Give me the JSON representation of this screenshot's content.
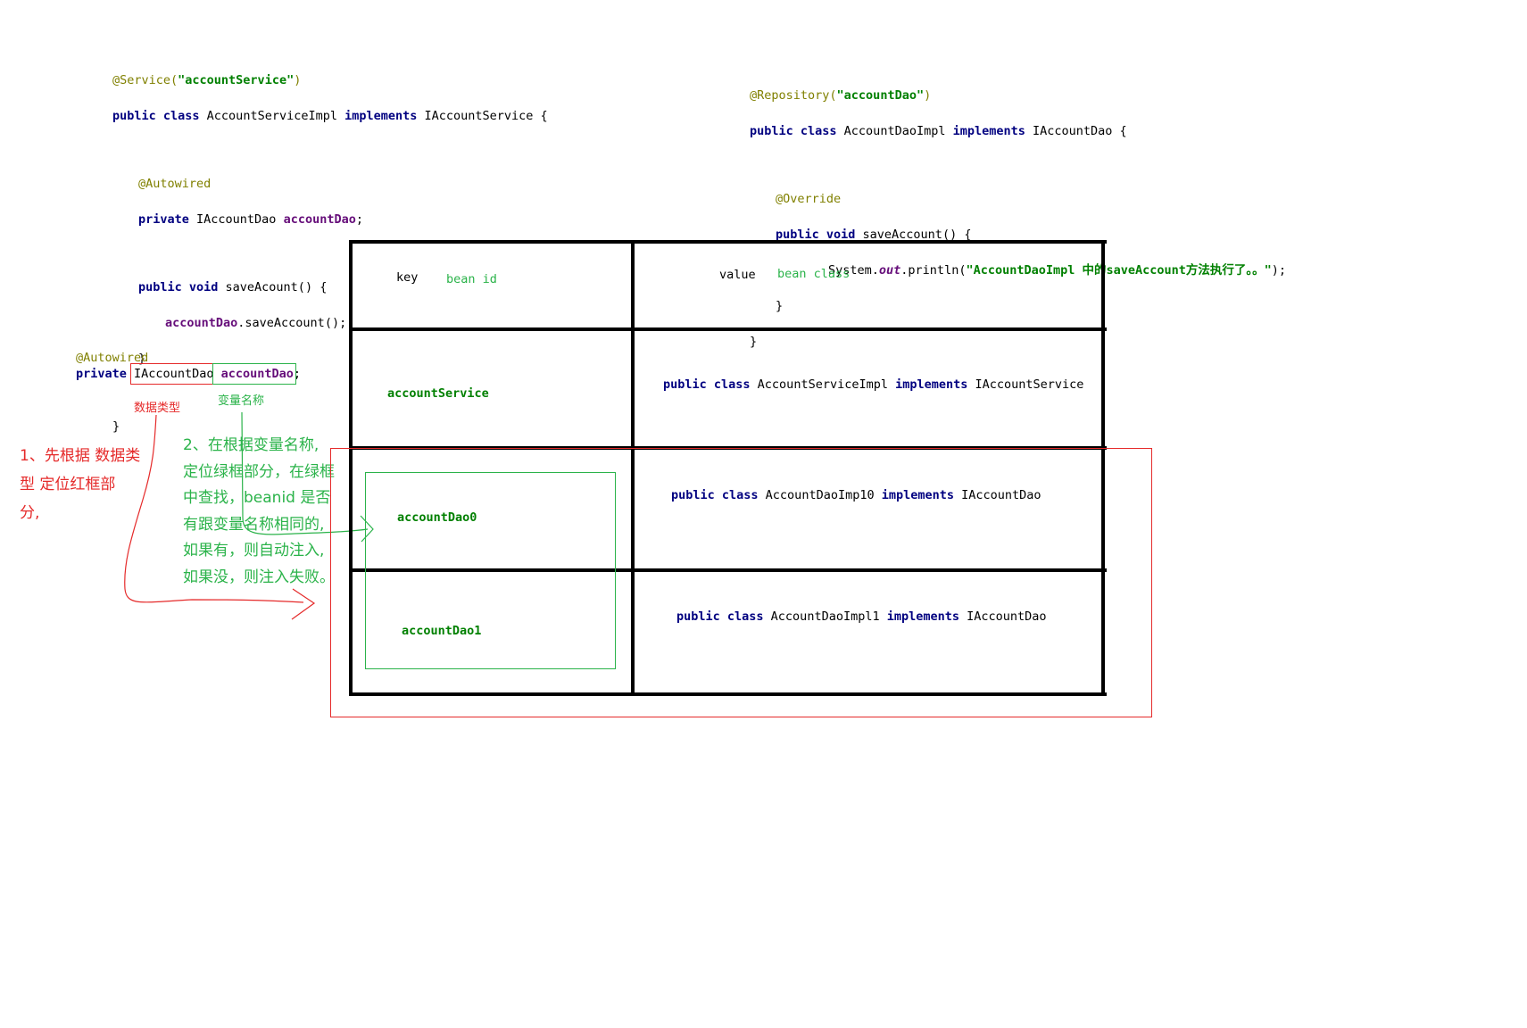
{
  "service_code": {
    "ann_service": "@Service(",
    "ann_service_arg": "\"accountService\"",
    "ann_service_close": ")",
    "line2_kw": "public class",
    "line2_name": " AccountServiceImpl ",
    "line2_impl": "implements",
    "line2_rest": " IAccountService {",
    "autowired": "@Autowired",
    "field_kw": "private",
    "field_type": " IAccountDao ",
    "field_name": "accountDao",
    "field_end": ";",
    "method_kw": "public void",
    "method_sig": " saveAcount() {",
    "call_obj": "accountDao",
    "call_rest": ".saveAccount();",
    "method_close": "}",
    "class_close": "}"
  },
  "dao_code": {
    "ann_repo": "@Repository(",
    "ann_repo_arg": "\"accountDao\"",
    "ann_repo_close": ")",
    "line2_kw": "public class",
    "line2_name": " AccountDaoImpl ",
    "line2_impl": "implements",
    "line2_rest": " IAccountDao {",
    "override": "@Override",
    "method_kw": "public void",
    "method_sig": " saveAccount() {",
    "print_prefix": "System.",
    "print_out": "out",
    "print_mid": ".println(",
    "print_str": "\"AccountDaoImpl 中的saveAccount方法执行了。。\"",
    "print_end": ");",
    "method_close": "}",
    "class_close": "}"
  },
  "left_snippet": {
    "autowired": "@Autowired",
    "kw": "private",
    "type": "IAccountDao",
    "name": "accountDao",
    "semi": ";",
    "type_label": "数据类型",
    "name_label": "变量名称"
  },
  "notes": {
    "red": [
      "1、先根据 数据类",
      "型 定位红框部",
      "分,"
    ],
    "green": [
      "2、在根据变量名称,",
      "定位绿框部分，在绿框",
      "中查找，beanid 是否",
      "有跟变量名称相同的,",
      "如果有，则自动注入,",
      "如果没，则注入失败。"
    ]
  },
  "table": {
    "header_key": "key",
    "header_key_hint": "bean id",
    "header_value": "value",
    "header_value_hint": "bean class",
    "rows": [
      {
        "key": "accountService",
        "value_kw1": "public class",
        "value_name": " AccountServiceImpl ",
        "value_kw2": "implements",
        "value_rest": " IAccountService"
      },
      {
        "key": "accountDao0",
        "value_kw1": "public class",
        "value_name": " AccountDaoImp10 ",
        "value_kw2": "implements",
        "value_rest": " IAccountDao"
      },
      {
        "key": "accountDao1",
        "value_kw1": "public class",
        "value_name": " AccountDaoImpl1 ",
        "value_kw2": "implements",
        "value_rest": " IAccountDao"
      }
    ]
  },
  "colors": {
    "red": "#e52a2a",
    "green": "#2bb34a",
    "keyword": "#000080",
    "annotation": "#808000",
    "string": "#008000"
  }
}
